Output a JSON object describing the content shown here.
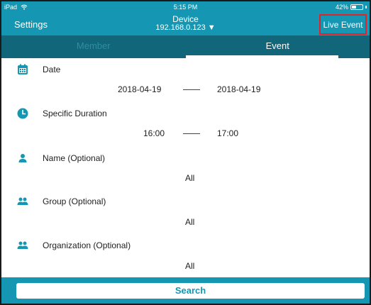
{
  "status_bar": {
    "device": "iPad",
    "time": "5:15 PM",
    "battery": "42%",
    "battery_level": 0.42
  },
  "nav": {
    "left": "Settings",
    "title": "Device",
    "subtitle": "192.168.0.123 ▼",
    "right": "Live Event"
  },
  "tabs": [
    {
      "label": "Member",
      "active": false
    },
    {
      "label": "Event",
      "active": true
    }
  ],
  "date": {
    "label": "Date",
    "start": "2018-04-19",
    "end": "2018-04-19"
  },
  "duration": {
    "label": "Specific Duration",
    "start": "16:00",
    "end": "17:00"
  },
  "name": {
    "label": "Name (Optional)",
    "value": "All"
  },
  "group": {
    "label": "Group (Optional)",
    "value": "All"
  },
  "organization": {
    "label": "Organization (Optional)",
    "value": "All"
  },
  "search": {
    "label": "Search"
  },
  "colors": {
    "accent": "#1597b3",
    "tab_bg": "#12667a",
    "highlight_border": "#e0242b"
  },
  "icons": {
    "wifi": "wifi-icon",
    "calendar": "calendar-icon",
    "clock": "clock-icon",
    "person": "person-icon",
    "group": "group-icon"
  }
}
